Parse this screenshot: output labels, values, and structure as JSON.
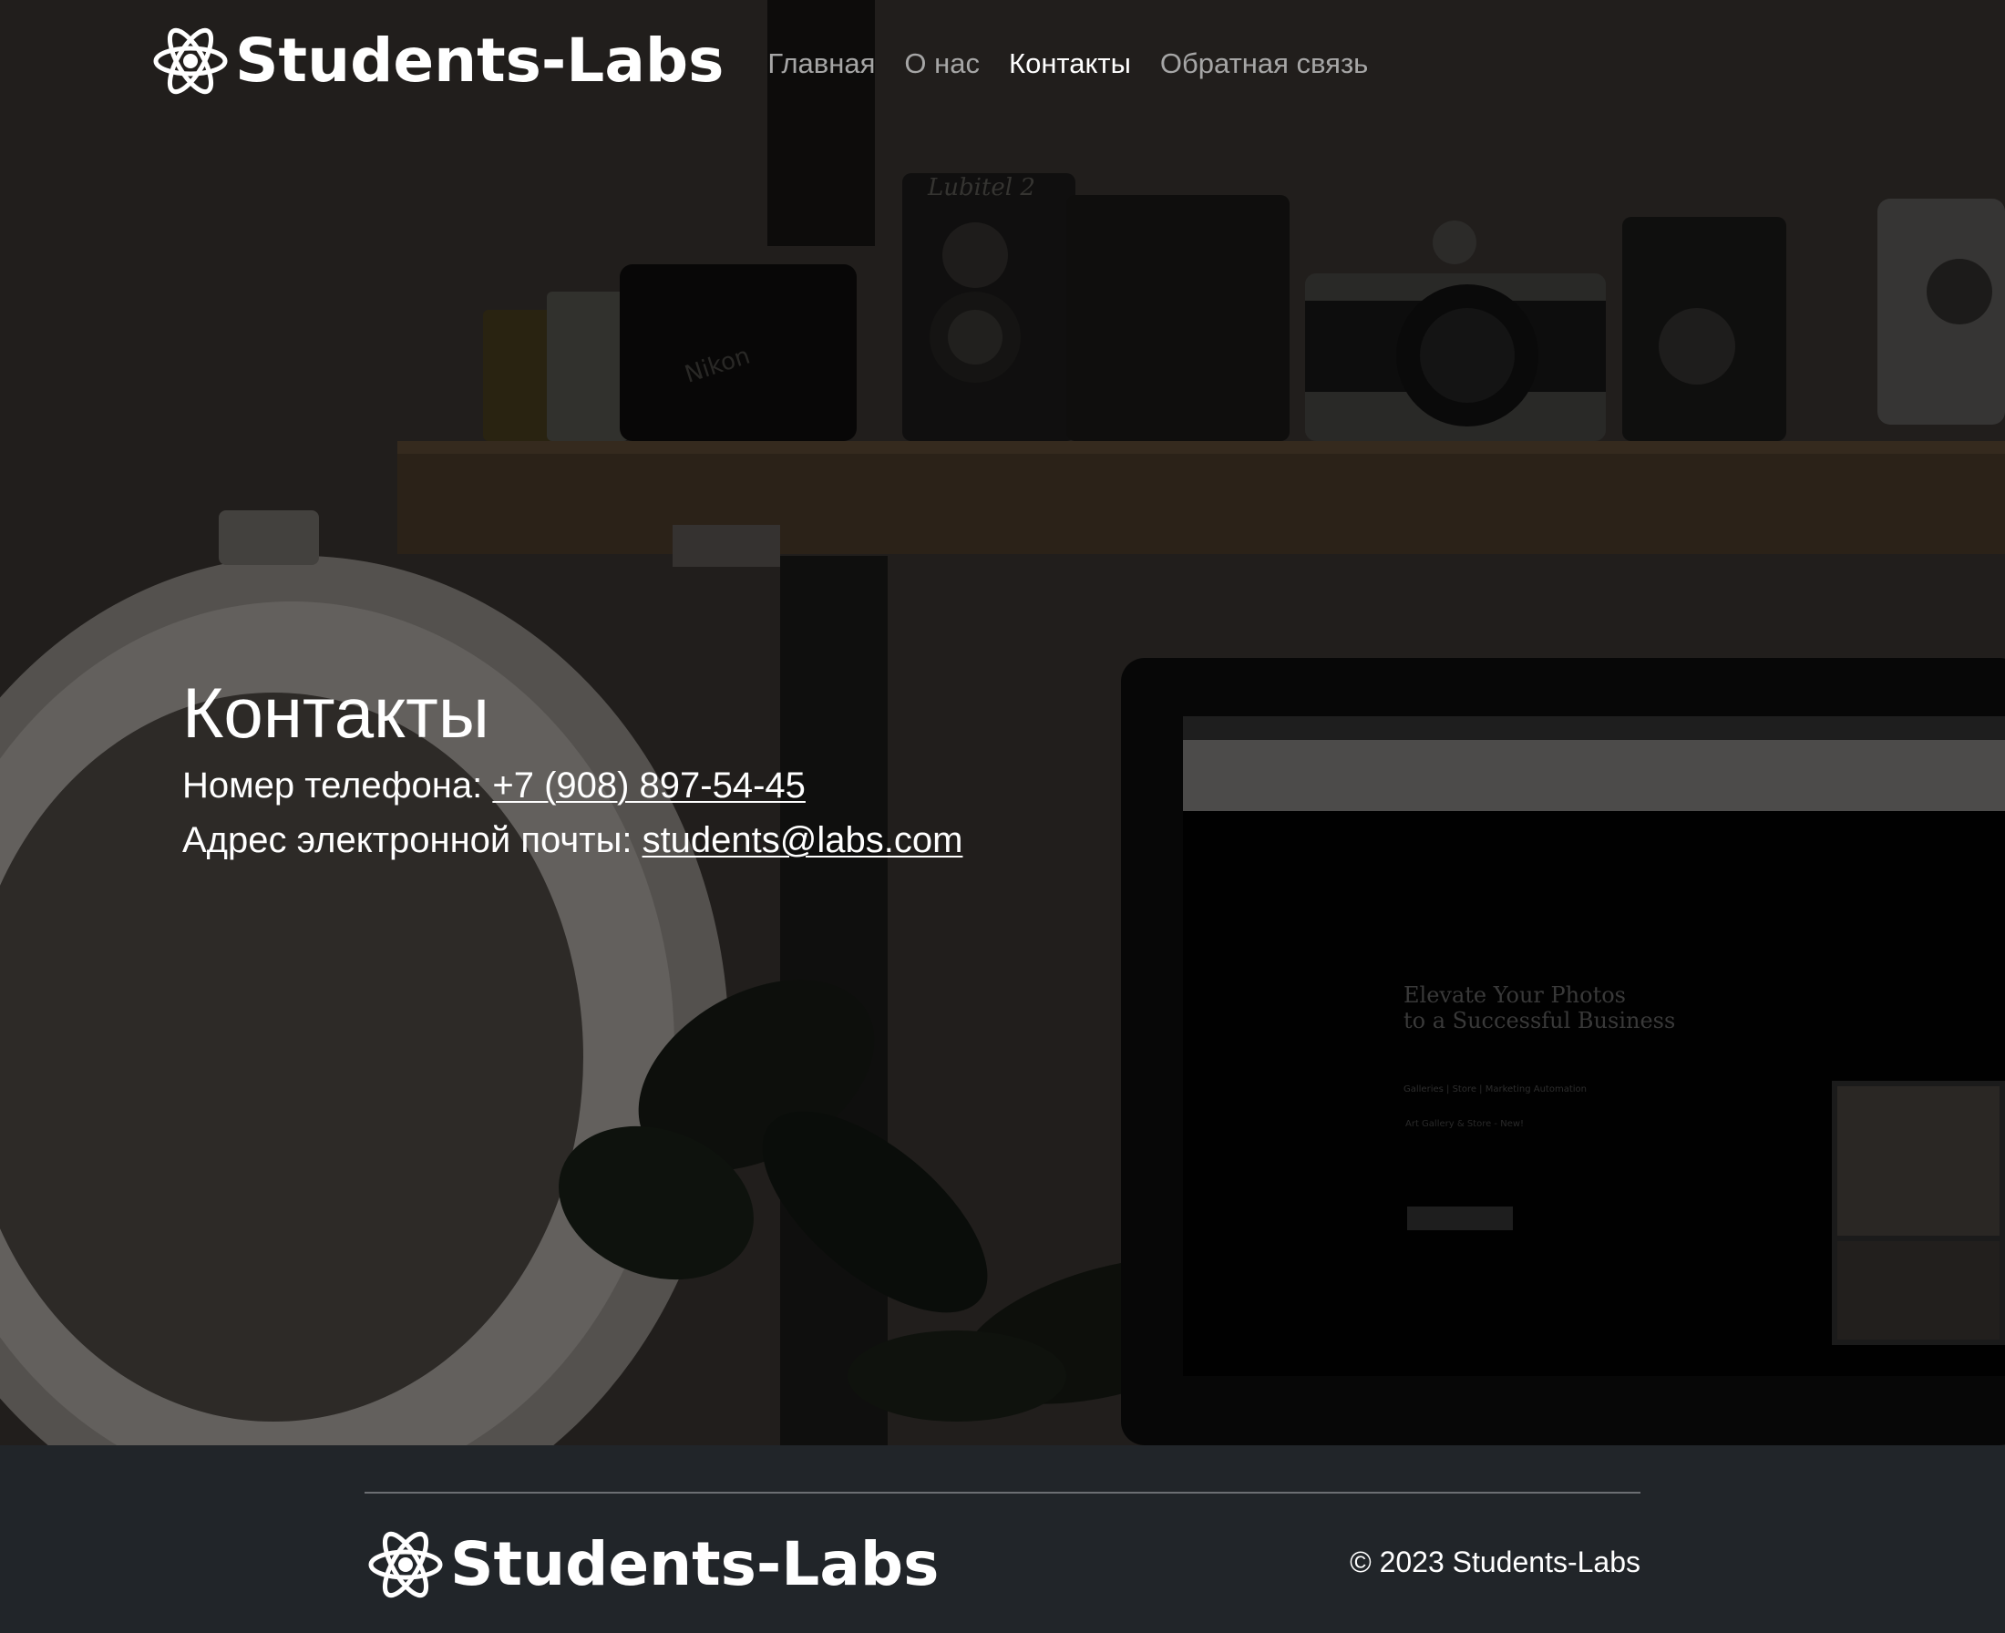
{
  "header": {
    "brand": "Students-Labs",
    "nav": [
      {
        "label": "Главная",
        "active": false
      },
      {
        "label": "О нас",
        "active": false
      },
      {
        "label": "Контакты",
        "active": true
      },
      {
        "label": "Обратная связь",
        "active": false
      }
    ]
  },
  "hero": {
    "background_description_icon": "atom-logo-icon",
    "screen_text": {
      "line1": "Elevate Your Photos",
      "line2": "to a Successful Business",
      "menu": "Galleries   |   Store   |   Marketing Automation",
      "sub": "Art Gallery & Store - New!"
    },
    "camera_label": "Lubitel 2",
    "camera_label2": "Nikon"
  },
  "contacts": {
    "title": "Контакты",
    "phone_label": "Номер телефона: ",
    "phone_value": "+7 (908) 897-54-45",
    "email_label": "Адрес электронной почты: ",
    "email_value": "students@labs.com"
  },
  "footer": {
    "brand": "Students-Labs",
    "copyright": "© 2023 Students-Labs"
  },
  "colors": {
    "footer_bg": "#212529",
    "nav_inactive": "#a6a6a6",
    "nav_active": "#ffffff",
    "text": "#ffffff"
  }
}
